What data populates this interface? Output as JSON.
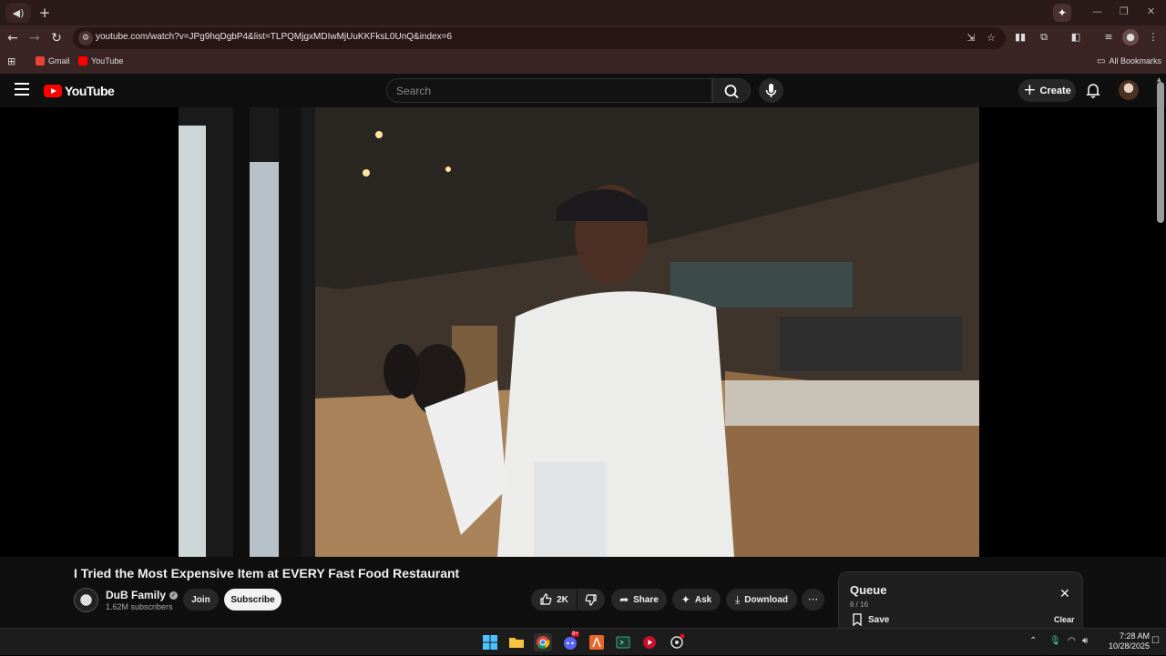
{
  "browser": {
    "tab_icon": "speaker-icon",
    "new_tab": "+",
    "url": "youtube.com/watch?v=JPg9hqDgbP4&list=TLPQMjgxMDIwMjUuKKFksL0UnQ&index=6",
    "bookmarks": [
      {
        "label": "Gmail",
        "color": "#ea4335"
      },
      {
        "label": "YouTube",
        "color": "#ff0000"
      }
    ],
    "all_bookmarks": "All Bookmarks"
  },
  "youtube": {
    "logo_text": "YouTube",
    "search_placeholder": "Search",
    "create_label": "Create"
  },
  "video": {
    "title": "I Tried the Most Expensive Item at EVERY Fast Food Restaurant",
    "channel": "DuB Family",
    "subscribers": "1.62M subscribers",
    "join_label": "Join",
    "subscribe_label": "Subscribe",
    "likes": "2K",
    "share_label": "Share",
    "ask_label": "Ask",
    "download_label": "Download"
  },
  "queue": {
    "title": "Queue",
    "count": "6 / 16",
    "save_label": "Save",
    "clear_label": "Clear"
  },
  "taskbar": {
    "time": "7:28 AM",
    "date": "10/28/2025",
    "discord_badge": "9+"
  }
}
